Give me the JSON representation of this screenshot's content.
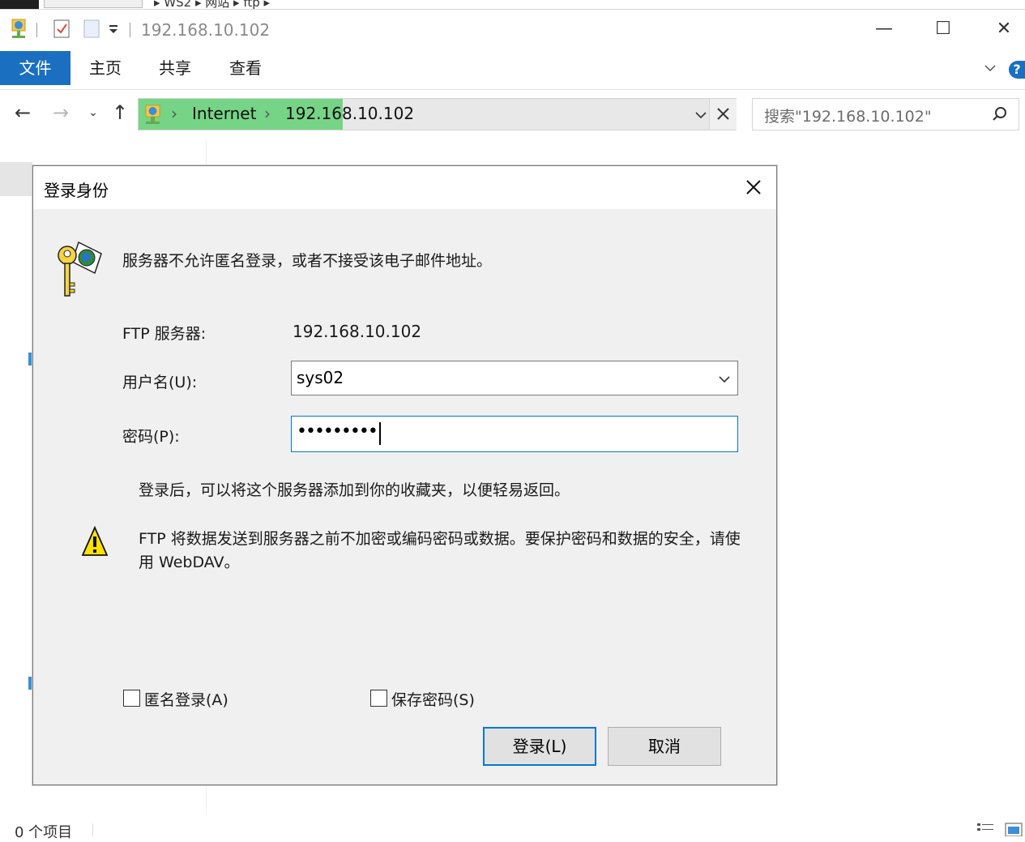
{
  "top_strip": {
    "breadcrumb_partial": "▸ WS2 ▸ 网站 ▸ ftp ▸"
  },
  "window": {
    "title": "192.168.10.102",
    "controls": {
      "minimize": "—",
      "maximize": "☐",
      "close": "✕"
    }
  },
  "ribbon": {
    "tabs": [
      "文件",
      "主页",
      "共享",
      "查看"
    ],
    "help": "?"
  },
  "address_bar": {
    "segments": [
      "Internet",
      "192.168.10.102"
    ],
    "separator": "›"
  },
  "search": {
    "placeholder": "搜索\"192.168.10.102\""
  },
  "status_bar": {
    "item_count": "0 个项目"
  },
  "dialog": {
    "title": "登录身份",
    "message": "服务器不允许匿名登录，或者不接受该电子邮件地址。",
    "ftp_server_label": "FTP 服务器:",
    "ftp_server_value": "192.168.10.102",
    "username_label": "用户名(U):",
    "username_value": "sys02",
    "password_label": "密码(P):",
    "password_value": "•••••••••",
    "info_text": "登录后，可以将这个服务器添加到你的收藏夹，以便轻易返回。",
    "warning_line1": "FTP 将数据发送到服务器之前不加密或编码密码或数据。要保护密码和数据的安全，请使",
    "warning_line2": "用 WebDAV。",
    "anonymous_label": "匿名登录(A)",
    "save_password_label": "保存密码(S)",
    "login_button": "登录(L)",
    "cancel_button": "取消"
  },
  "colors": {
    "accent": "#1a6fc1",
    "focus": "#0078d7",
    "dialog_bg": "#f0f0f0"
  }
}
